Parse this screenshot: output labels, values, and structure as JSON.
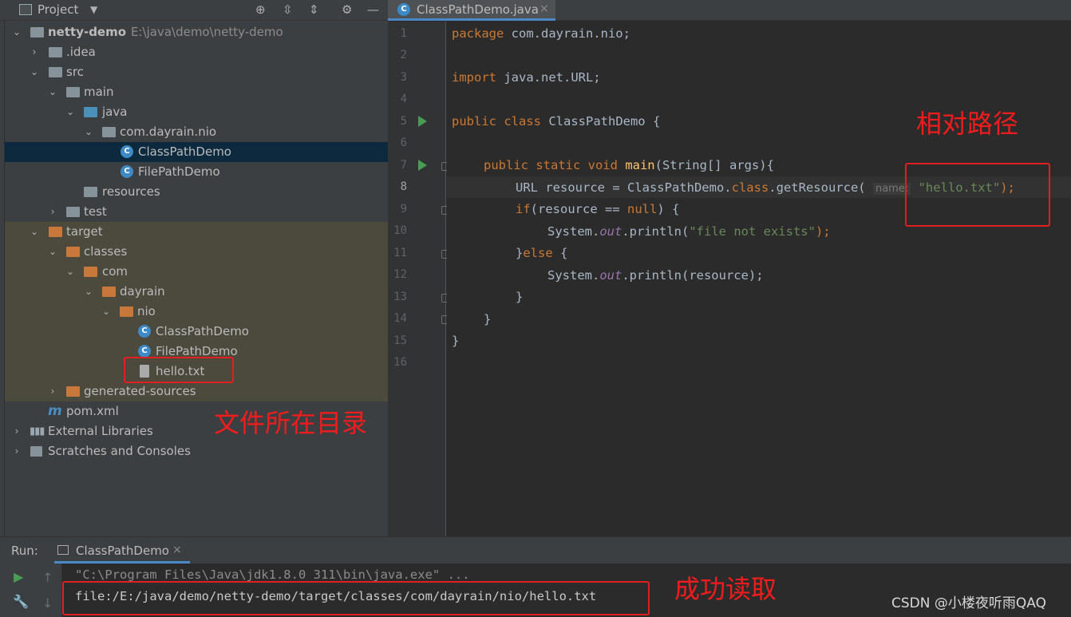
{
  "project_toolbar": {
    "title": "Project",
    "dropdown_icon": "chevron-down-icon",
    "icons": [
      "locate-icon",
      "expand-all-icon",
      "collapse-all-icon",
      "gear-icon",
      "minimize-icon"
    ]
  },
  "tree": [
    {
      "label": "netty-demo",
      "extra": "E:\\java\\demo\\netty-demo",
      "icon": "module-folder"
    },
    {
      "label": ".idea",
      "icon": "folder"
    },
    {
      "label": "src",
      "icon": "folder"
    },
    {
      "label": "main",
      "icon": "folder"
    },
    {
      "label": "java",
      "icon": "source-folder"
    },
    {
      "label": "com.dayrain.nio",
      "icon": "package"
    },
    {
      "label": "ClassPathDemo",
      "icon": "class"
    },
    {
      "label": "FilePathDemo",
      "icon": "class"
    },
    {
      "label": "resources",
      "icon": "resources-folder"
    },
    {
      "label": "test",
      "icon": "folder"
    },
    {
      "label": "target",
      "icon": "excluded-folder"
    },
    {
      "label": "classes",
      "icon": "excluded-folder"
    },
    {
      "label": "com",
      "icon": "excluded-folder"
    },
    {
      "label": "dayrain",
      "icon": "excluded-folder"
    },
    {
      "label": "nio",
      "icon": "excluded-folder"
    },
    {
      "label": "ClassPathDemo",
      "icon": "class"
    },
    {
      "label": "FilePathDemo",
      "icon": "class"
    },
    {
      "label": "hello.txt",
      "icon": "text-file"
    },
    {
      "label": "generated-sources",
      "icon": "excluded-folder"
    },
    {
      "label": "pom.xml",
      "icon": "maven"
    },
    {
      "label": "External Libraries",
      "icon": "libraries"
    },
    {
      "label": "Scratches and Consoles",
      "icon": "scratches"
    }
  ],
  "editor": {
    "tab": "ClassPathDemo.java",
    "close": "×",
    "line_numbers": [
      "1",
      "2",
      "3",
      "4",
      "5",
      "6",
      "7",
      "8",
      "9",
      "10",
      "11",
      "12",
      "13",
      "14",
      "15",
      "16"
    ],
    "code": {
      "l1_kw": "package ",
      "l1_rest": "com.dayrain.nio;",
      "l3_kw": "import ",
      "l3_rest": "java.net.URL;",
      "l5_kw": "public class ",
      "l5_rest": "ClassPathDemo {",
      "l7_kw": "public static void ",
      "l7_fn": "main",
      "l7_rest": "(String[] args){",
      "l8_a": "URL resource = ClassPathDemo.",
      "l8_kw": "class",
      "l8_b": ".getResource( ",
      "l8_hint": "name:",
      "l8_str": "\"hello.txt\"",
      "l8_c": ");",
      "l9_kw": "if",
      "l9_a": "(resource == ",
      "l9_kw2": "null",
      "l9_b": ") {",
      "l10_a": "System.",
      "l10_it": "out",
      "l10_b": ".println(",
      "l10_str": "\"file not exists\"",
      "l10_c": ");",
      "l11_a": "}",
      "l11_kw": "else",
      "l11_b": " {",
      "l12_a": "System.",
      "l12_it": "out",
      "l12_b": ".println(resource);",
      "l13": "}",
      "l14": "}",
      "l15": "}"
    }
  },
  "run": {
    "label": "Run:",
    "tab": "ClassPathDemo",
    "close": "×",
    "console": [
      "\"C:\\Program Files\\Java\\jdk1.8.0_311\\bin\\java.exe\" ...",
      "file:/E:/java/demo/netty-demo/target/classes/com/dayrain/nio/hello.txt"
    ]
  },
  "annotations": {
    "relative_path": "相对路径",
    "file_dir": "文件所在目录",
    "read_success": "成功读取"
  },
  "watermark": "CSDN @小楼夜听雨QAQ",
  "colors": {
    "accent": "#4a88c7",
    "annotation_red": "#e02020",
    "keyword": "#cc7832",
    "string": "#6a8759"
  }
}
